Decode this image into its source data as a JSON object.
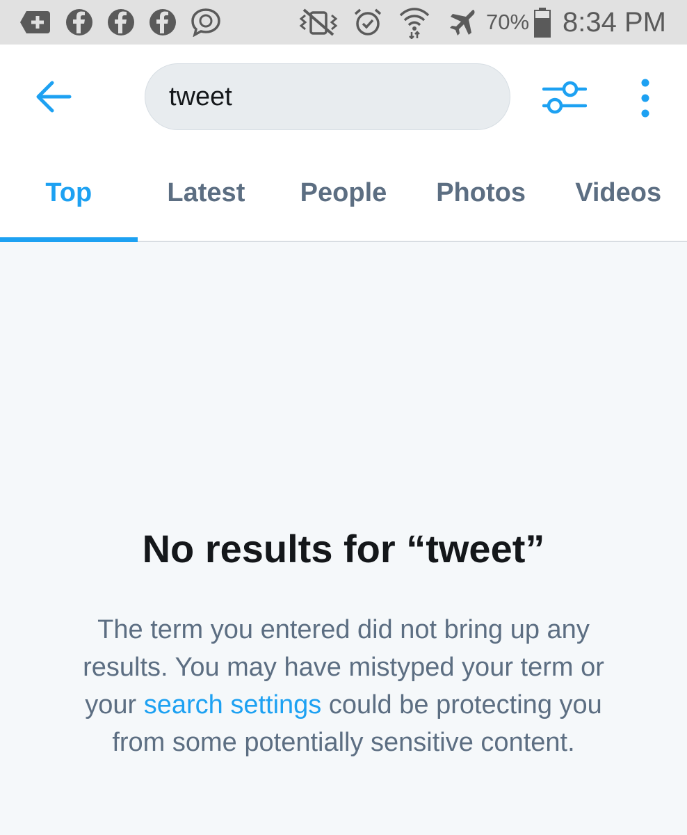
{
  "status_bar": {
    "left_icons": [
      "add-box-icon",
      "facebook-icon",
      "facebook-icon",
      "facebook-icon",
      "chat-bubble-icon"
    ],
    "right_icons": [
      "vibrate-mute-icon",
      "alarm-icon",
      "wifi-icon",
      "airplane-mode-icon",
      "battery-icon"
    ],
    "battery": "70%",
    "time": "8:34 PM"
  },
  "app_bar": {
    "back_icon": "arrow-left-icon",
    "search_value": "tweet",
    "filter_icon": "sliders-icon",
    "more_icon": "more-vertical-icon"
  },
  "tabs": [
    {
      "label": "Top",
      "active": true
    },
    {
      "label": "Latest",
      "active": false
    },
    {
      "label": "People",
      "active": false
    },
    {
      "label": "Photos",
      "active": false
    },
    {
      "label": "Videos",
      "active": false
    }
  ],
  "empty_state": {
    "title": "No results for “tweet”",
    "body_before": "The term you entered did not bring up any results. You may have mistyped your term or your ",
    "link": "search settings",
    "body_after": " could be protecting you from some potentially sensitive content."
  },
  "colors": {
    "accent": "#1da1f2",
    "tab_inactive": "#5c6e82",
    "background": "#f5f8fa",
    "status_bar": "#e1e1e1"
  }
}
